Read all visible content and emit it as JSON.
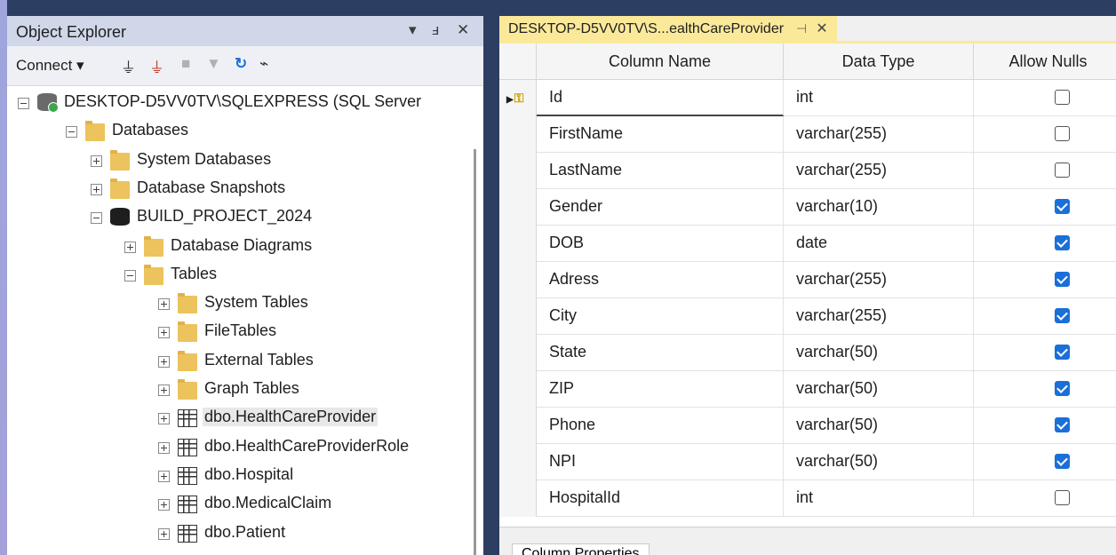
{
  "object_explorer": {
    "title": "Object Explorer",
    "pin_glyph": "▾ ⫠ ✕",
    "connect_label": "Connect ▾",
    "tree": [
      {
        "label": "DESKTOP-D5VV0TV\\SQLEXPRESS (SQL Server",
        "icon": "server-icon"
      },
      {
        "label": "Databases",
        "icon": "folder-icon"
      },
      {
        "label": "System Databases",
        "icon": "folder-icon"
      },
      {
        "label": "Database Snapshots",
        "icon": "folder-icon"
      },
      {
        "label": "BUILD_PROJECT_2024",
        "icon": "database-icon"
      },
      {
        "label": "Database Diagrams",
        "icon": "folder-icon"
      },
      {
        "label": "Tables",
        "icon": "folder-icon"
      },
      {
        "label": "System Tables",
        "icon": "folder-icon"
      },
      {
        "label": "FileTables",
        "icon": "folder-icon"
      },
      {
        "label": "External Tables",
        "icon": "folder-icon"
      },
      {
        "label": "Graph Tables",
        "icon": "folder-icon"
      },
      {
        "label": "dbo.HealthCareProvider",
        "icon": "table-icon"
      },
      {
        "label": "dbo.HealthCareProviderRole",
        "icon": "table-icon"
      },
      {
        "label": "dbo.Hospital",
        "icon": "table-icon"
      },
      {
        "label": "dbo.MedicalClaim",
        "icon": "table-icon"
      },
      {
        "label": "dbo.Patient",
        "icon": "table-icon"
      }
    ]
  },
  "designer": {
    "tab_label": "DESKTOP-D5VV0TV\\S...ealthCareProvider",
    "headers": {
      "name": "Column Name",
      "type": "Data Type",
      "nulls": "Allow Nulls"
    },
    "columns": [
      {
        "name": "Id",
        "type": "int",
        "allow_nulls": false,
        "primary_key": true
      },
      {
        "name": "FirstName",
        "type": "varchar(255)",
        "allow_nulls": false
      },
      {
        "name": "LastName",
        "type": "varchar(255)",
        "allow_nulls": false
      },
      {
        "name": "Gender",
        "type": "varchar(10)",
        "allow_nulls": true
      },
      {
        "name": "DOB",
        "type": "date",
        "allow_nulls": true
      },
      {
        "name": "Adress",
        "type": "varchar(255)",
        "allow_nulls": true
      },
      {
        "name": "City",
        "type": "varchar(255)",
        "allow_nulls": true
      },
      {
        "name": "State",
        "type": "varchar(50)",
        "allow_nulls": true
      },
      {
        "name": "ZIP",
        "type": "varchar(50)",
        "allow_nulls": true
      },
      {
        "name": "Phone",
        "type": "varchar(50)",
        "allow_nulls": true
      },
      {
        "name": "NPI",
        "type": "varchar(50)",
        "allow_nulls": true
      },
      {
        "name": "HospitalId",
        "type": "int",
        "allow_nulls": false
      }
    ],
    "properties_tab": "Column Properties"
  },
  "colors": {
    "tab_active": "#fbe99a",
    "checkbox_on": "#1a6fd8",
    "frame": "#2d3e63"
  }
}
